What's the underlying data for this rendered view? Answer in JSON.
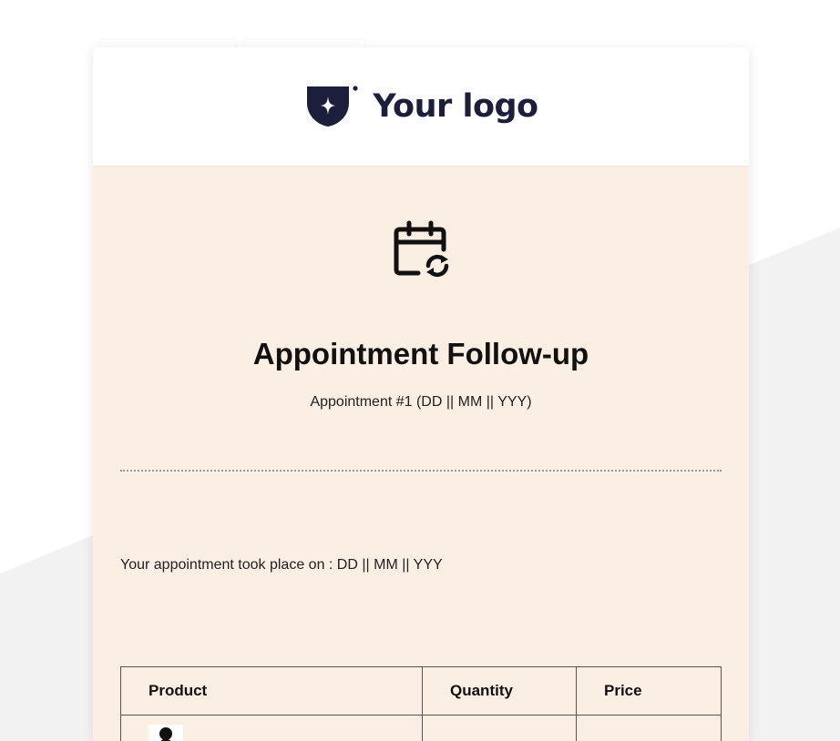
{
  "logo": {
    "text": "Your logo",
    "icon": "shield-star-logo-icon",
    "color": "#1b1f3b"
  },
  "hero": {
    "icon": "calendar-refresh-icon"
  },
  "email": {
    "title": "Appointment Follow-up",
    "subtitle": "Appointment #1 (DD || MM || YYY)",
    "body": "Your appointment took place on : DD || MM || YYY"
  },
  "table": {
    "headers": [
      "Product",
      "Quantity",
      "Price"
    ]
  },
  "colors": {
    "card_background": "#fbeee3",
    "header_background": "#ffffff",
    "page_background": "#ffffff",
    "background_shape": "#f2f2f3"
  }
}
